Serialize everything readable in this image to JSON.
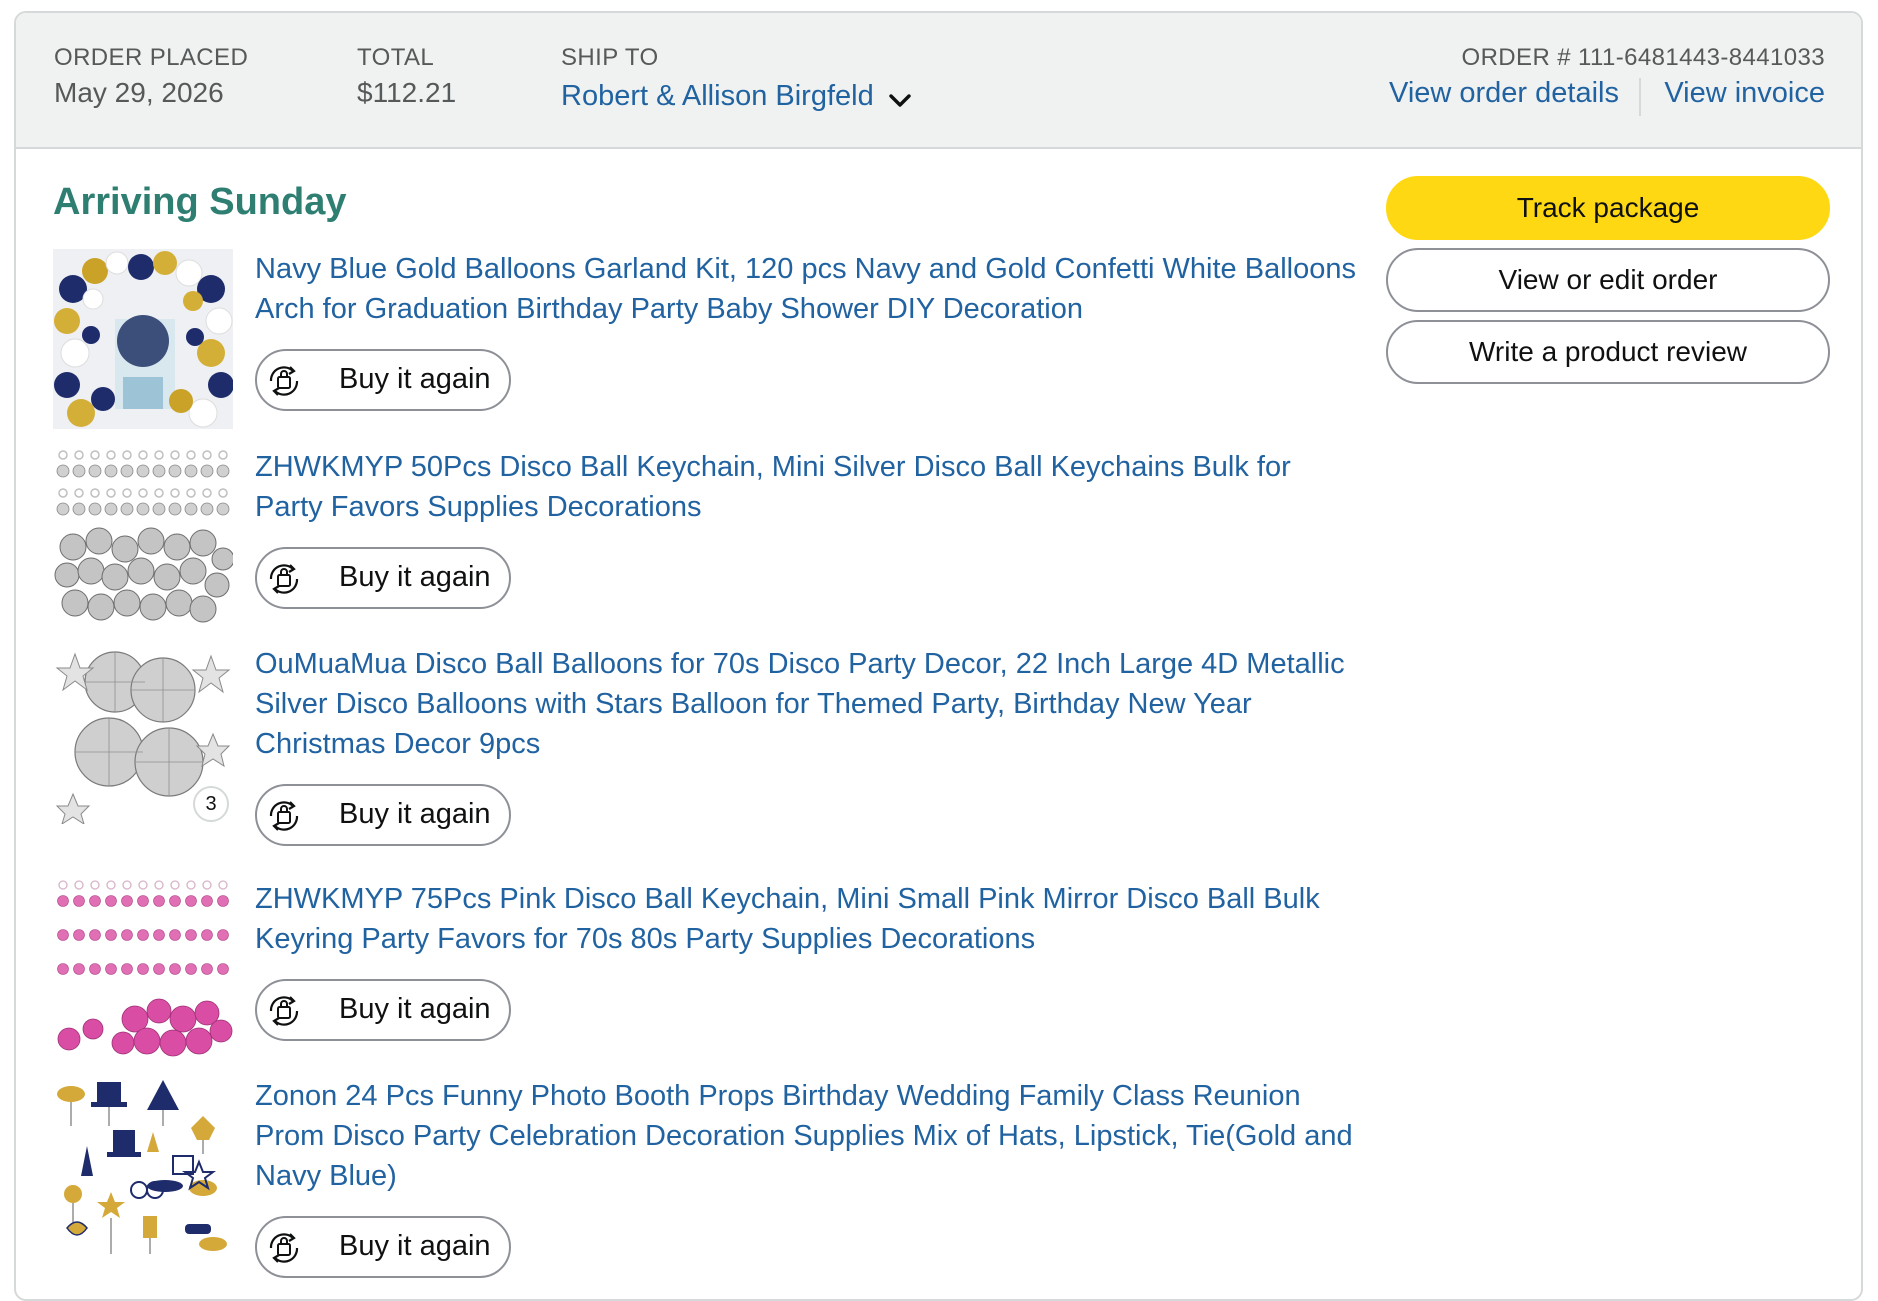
{
  "header": {
    "order_placed_label": "ORDER PLACED",
    "order_placed_value": "May 29, 2026",
    "total_label": "TOTAL",
    "total_value": "$112.21",
    "ship_to_label": "SHIP TO",
    "ship_to_value": "Robert & Allison Birgfeld",
    "order_number": "ORDER # 111-6481443-8441033",
    "view_order_details": "View order details",
    "view_invoice": "View invoice"
  },
  "shipment": {
    "status": "Arriving Sunday"
  },
  "items": [
    {
      "title": "Navy Blue Gold Balloons Garland Kit, 120 pcs Navy and Gold Confetti White Balloons Arch for Graduation Birthday Party Baby Shower DIY Decoration",
      "buy_again": "Buy it again"
    },
    {
      "title": "ZHWKMYP 50Pcs Disco Ball Keychain, Mini Silver Disco Ball Keychains Bulk for Party Favors Supplies Decorations",
      "buy_again": "Buy it again"
    },
    {
      "title": "OuMuaMua Disco Ball Balloons for 70s Disco Party Decor, 22 Inch Large 4D Metallic Silver Disco Balloons with Stars Balloon for Themed Party, Birthday New Year Christmas Decor 9pcs",
      "buy_again": "Buy it again",
      "quantity": "3"
    },
    {
      "title": "ZHWKMYP 75Pcs Pink Disco Ball Keychain, Mini Small Pink Mirror Disco Ball Bulk Keyring Party Favors for 70s 80s Party Supplies Decorations",
      "buy_again": "Buy it again"
    },
    {
      "title": "Zonon 24 Pcs Funny Photo Booth Props Birthday Wedding Family Class Reunion Prom Disco Party Celebration Decoration Supplies Mix of Hats, Lipstick, Tie(Gold and Navy Blue)",
      "buy_again": "Buy it again"
    }
  ],
  "actions": {
    "track_package": "Track package",
    "view_edit_order": "View or edit order",
    "write_review": "Write a product review"
  },
  "colors": {
    "link": "#2162a1",
    "arriving": "#2e7e72",
    "primary_button": "#ffd814",
    "header_bg": "#f0f2f2"
  }
}
